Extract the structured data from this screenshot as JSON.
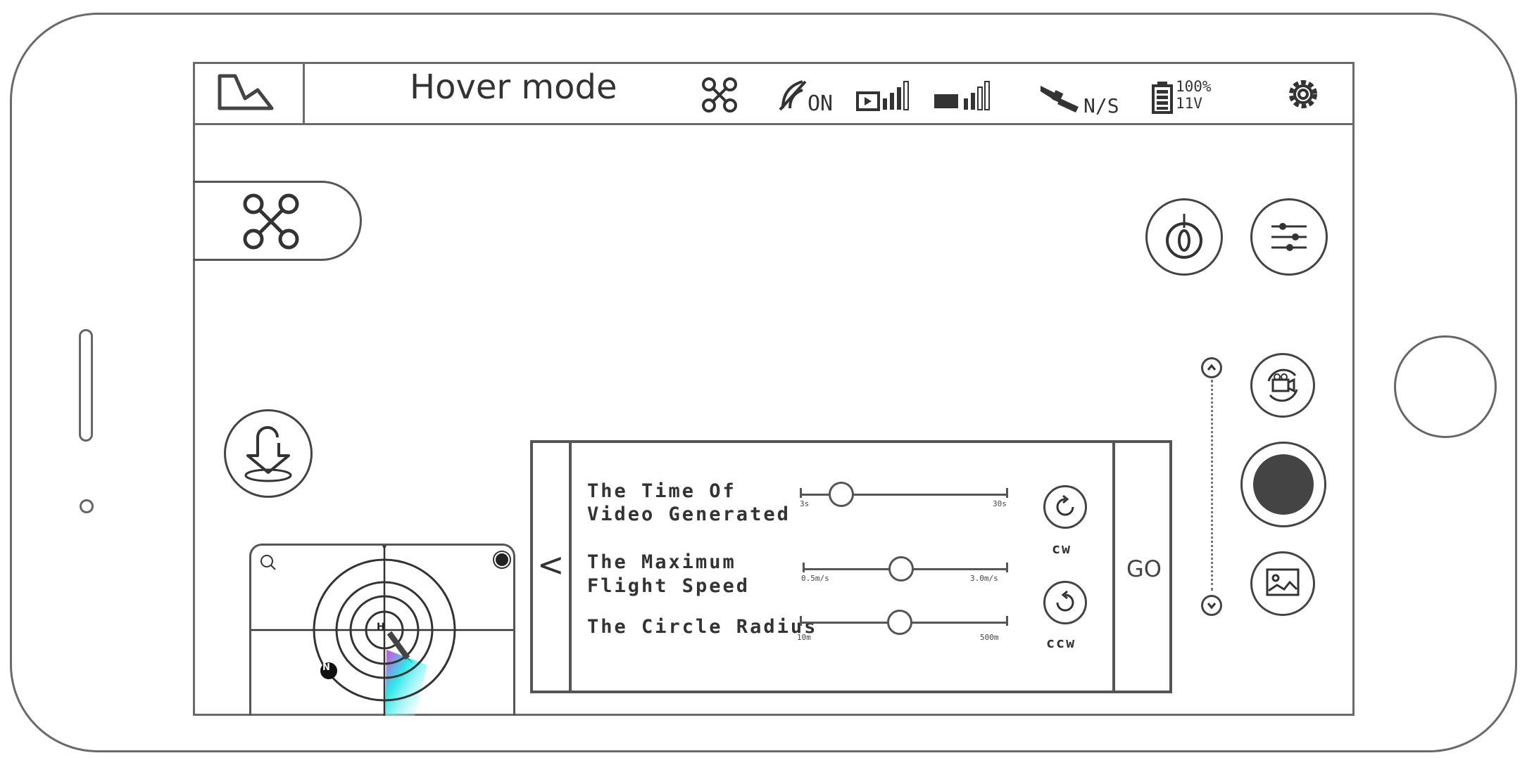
{
  "status_bar": {
    "mode_title": "Hover mode",
    "gps_toggle": "ON",
    "satellite_status": "N/S",
    "battery_percent": "100%",
    "battery_voltage": "11V",
    "video_signal_level": 3,
    "remote_signal_level": 2
  },
  "panel": {
    "collapse_glyph": "<",
    "go_label": "GO",
    "rows": [
      {
        "label_line1": "The Time Of",
        "label_line2": "Video Generated",
        "min_label": "3s",
        "max_label": "30s",
        "value_fraction": 0.2
      },
      {
        "label_line1": "The Maximum",
        "label_line2": "Flight Speed",
        "min_label": "0.5m/s",
        "max_label": "3.0m/s",
        "value_fraction": 0.48
      },
      {
        "label_line1": "The Circle Radius",
        "label_line2": "",
        "min_label": "10m",
        "max_label": "500m",
        "value_fraction": 0.48
      }
    ],
    "rotation": {
      "cw_label": "cw",
      "ccw_label": "ccw"
    }
  },
  "minimap": {
    "north_label": "N",
    "center_label": "H"
  },
  "icons": {
    "app_logo": "map-logo-icon",
    "drone": "drone-icon",
    "gps": "gps-icon",
    "video_signal": "video-signal-icon",
    "remote_signal": "remote-signal-icon",
    "satellite": "satellite-icon",
    "battery": "battery-icon",
    "settings": "gear-icon",
    "compass": "compass-icon",
    "adjust": "sliders-icon",
    "switch_camera": "switch-camera-icon",
    "record": "record-button",
    "gallery": "gallery-icon",
    "return_home": "return-home-icon",
    "zoom_up": "chevron-up-icon",
    "zoom_down": "chevron-down-icon"
  },
  "colors": {
    "outline": "#6a6a6a",
    "record_fill": "#444444",
    "heading_cone": "#2ee8e8",
    "heading_accent": "#e040e0"
  }
}
